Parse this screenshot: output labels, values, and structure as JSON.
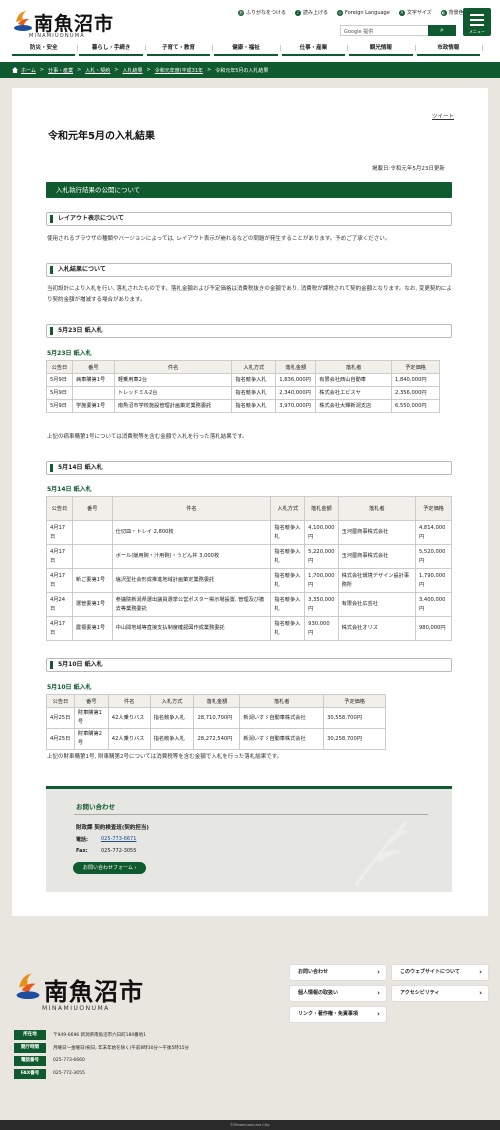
{
  "header": {
    "logo_kanji": "南魚沼市",
    "logo_roman": "MINAMIUONUMA",
    "util_links": [
      {
        "icon": "furigana-icon",
        "label": "ふりがなをつける"
      },
      {
        "icon": "speaker-icon",
        "label": "読み上げる"
      },
      {
        "icon": "globe-icon",
        "label": "Foreign Language"
      },
      {
        "icon": "text-size-icon",
        "label": "文字サイズ"
      },
      {
        "icon": "contrast-icon",
        "label": "背景色"
      }
    ],
    "search_placeholder": "Google 提供",
    "search_icon": "search-icon",
    "menu_label": "メニュー",
    "nav": [
      "防災・安全",
      "暮らし・手続き",
      "子育て・教育",
      "健康・福祉",
      "仕事・産業",
      "観光情報",
      "市政情報"
    ]
  },
  "breadcrumb": [
    "ホーム",
    "仕事・産業",
    "入札・契約",
    "入札結果",
    "令和元年度(平成31年",
    "令和元年5月の入札結果"
  ],
  "main": {
    "tweet": "ツイート",
    "title": "令和元年5月の入札結果",
    "pubdate": "掲載日:令和元年5月23日更新",
    "section_heading": "入札執行結果の公開について",
    "layout_heading": "レイアウト表示について",
    "layout_text": "使用されるブラウザの種類やバージョンによっては, レイアウト表示が崩れるなどの問題が発生することがあります。予めご了承ください。",
    "results_heading": "入札結果について",
    "results_text": "当初設計により入札を行い, 落札されたものです。落札金額および予定価格は消費税抜きの金額であり, 消費税が課税されて契約金額となります。なお, 変更契約により契約金額が増減する場合があります。",
    "columns_short": [
      "公告日",
      "番号",
      "件名",
      "入札方式",
      "落札金額",
      "落札者",
      "予定価格"
    ],
    "block1": {
      "heading": "5月23日 紙入札",
      "sub": "5月23日 紙入札",
      "rows": [
        [
          "5月9日",
          "病車購第1号",
          "軽乗用車2台",
          "指名競争入札",
          "1,836,000円",
          "有限会社西山自動車",
          "1,840,000円"
        ],
        [
          "5月9日",
          "",
          "トレッドミル2台",
          "指名競争入札",
          "2,340,000円",
          "株式会社エビスヤ",
          "2,356,000円"
        ],
        [
          "5月9日",
          "学施委第1号",
          "南魚沼市学校施設管理計画策定業務委託",
          "指名競争入札",
          "3,970,000円",
          "株式会社大輝新潟支店",
          "6,550,000円"
        ]
      ],
      "note": "上記の病車購第1号については消費税等を含む金額で入札を行った落札結果です。"
    },
    "block2": {
      "heading": "5月14日 紙入札",
      "sub": "5月14日 紙入札",
      "rows": [
        [
          "4月17日",
          "",
          "仕切皿・トレイ 2,800枚",
          "指名競争入札",
          "4,100,000円",
          "玉河屋商事株式会社",
          "4,814,000円"
        ],
        [
          "4月17日",
          "",
          "ボール(飯用碗・汁用碗)・うどん丼 3,000枚",
          "指名競争入札",
          "5,220,000円",
          "玉河屋商事株式会社",
          "5,520,000円"
        ],
        [
          "4月17日",
          "新ご委第1号",
          "塩沢型社会形成推進地域計画策定業務委託",
          "指名競争入札",
          "1,700,000円",
          "株式会社環境デザイン設計事務所",
          "1,790,000円"
        ],
        [
          "4月24日",
          "選管委第1号",
          "参議院新潟県選出議員選挙公営ポスター掲示場設置, 管理及び撤去等業務委託",
          "指名競争入札",
          "3,350,000円",
          "有限会社広芸社",
          "3,400,000円"
        ],
        [
          "4月17日",
          "農振委第1号",
          "中山間地域等直接支払制度確認図作成業務委託",
          "指名競争入札",
          "930,000円",
          "株式会社オリス",
          "980,000円"
        ]
      ]
    },
    "block3": {
      "heading": "5月10日 紙入札",
      "sub": "5月10日 紙入札",
      "rows": [
        [
          "4月25日",
          "財車購第1号",
          "42人乗りバス",
          "指名競争入札",
          "28,710,700円",
          "新潟いすゞ自動車株式会社",
          "30,558,700円"
        ],
        [
          "4月25日",
          "財車購第2号",
          "42人乗りバス",
          "指名競争入札",
          "28,272,540円",
          "新潟いすゞ自動車株式会社",
          "30,258,700円"
        ]
      ],
      "note": "上記の財車購第1号, 財車購第2号については消費税等を含む金額で入札を行った落札結果です。"
    },
    "contact": {
      "title": "お問い合わせ",
      "dept": "財政課 契約検査班(契約担当)",
      "tel_label": "電話:",
      "tel": "025-773-6671",
      "fax_label": "Fax:",
      "fax": "025-772-3055",
      "form_button": "お問い合わせフォーム"
    }
  },
  "footer": {
    "logo_kanji": "南魚沼市",
    "logo_roman": "MINAMIUONUMA",
    "info": [
      {
        "label": "所在地",
        "value": "〒949-6696 新潟県南魚沼市六日町180番地1"
      },
      {
        "label": "開庁時間",
        "value": "月曜日～金曜日(祝日, 年末年始を除く)午前8時30分～午後5時15分"
      },
      {
        "label": "電話番号",
        "value": "025-773-6660"
      },
      {
        "label": "FAX番号",
        "value": "025-772-3055"
      }
    ],
    "links": [
      "お問い合わせ",
      "このウェブサイトについて",
      "個人情報の取扱い",
      "アクセシビリティ",
      "リンク・著作権・免責事項"
    ],
    "copyright": "©Minamiuonuma City."
  },
  "colors": {
    "brand_green": "#0f5a2e",
    "footer_bg": "#e9e6e0"
  }
}
